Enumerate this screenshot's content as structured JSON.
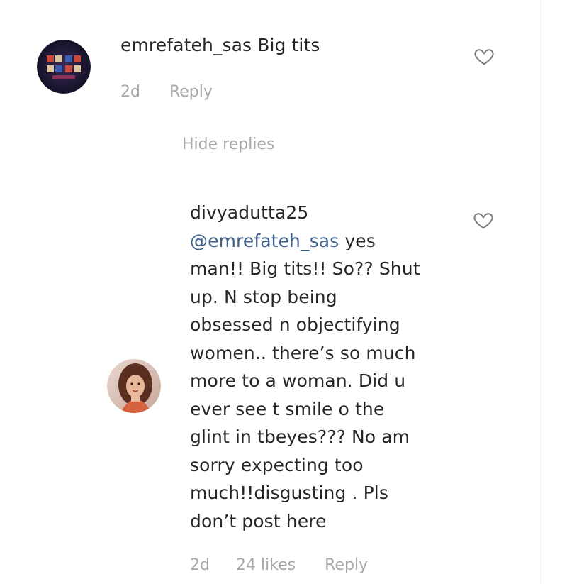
{
  "comment": {
    "username": "emrefateh_sas",
    "text": "Big tits",
    "time": "2d",
    "reply_label": "Reply",
    "avatar_icon": "team-badge-avatar"
  },
  "toggle": {
    "hide_replies_label": "Hide replies"
  },
  "reply": {
    "username": "divyadutta25",
    "mention": "@emrefateh_sas",
    "lines": [
      "yes",
      "man!! Big tits!! So?? Shut",
      "up. N stop being",
      "obsessed n objectifying",
      "women.. there’s so much",
      "more to a woman. Did u",
      "ever see t smile o the",
      "glint in tbeyes??? No am",
      "sorry expecting too",
      "much!!disgusting . Pls",
      "don’t post here"
    ],
    "time": "2d",
    "likes": "24 likes",
    "reply_label": "Reply",
    "avatar_icon": "woman-portrait-avatar"
  },
  "icons": {
    "like": "heart-outline-icon"
  },
  "colors": {
    "text": "#262626",
    "meta": "#a8a8a8",
    "mention": "#3f5f8a"
  }
}
